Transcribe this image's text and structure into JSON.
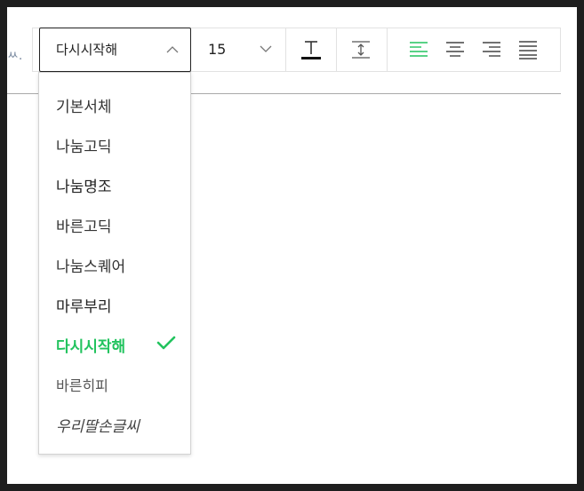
{
  "editor": {
    "left_fragment": "ㅆ."
  },
  "toolbar": {
    "font": {
      "selected": "다시시작해",
      "chevron_icon": "chevron-up-icon",
      "options": [
        {
          "label": "기본서체",
          "selected": false
        },
        {
          "label": "나눔고딕",
          "selected": false
        },
        {
          "label": "나눔명조",
          "selected": false
        },
        {
          "label": "바른고딕",
          "selected": false
        },
        {
          "label": "나눔스퀘어",
          "selected": false
        },
        {
          "label": "마루부리",
          "selected": false
        },
        {
          "label": "다시시작해",
          "selected": true
        },
        {
          "label": "바른히피",
          "selected": false
        },
        {
          "label": "우리딸손글씨",
          "selected": false
        }
      ]
    },
    "size": {
      "value": "15",
      "chevron_icon": "chevron-down-icon"
    },
    "buttons": [
      {
        "name": "text-color-button",
        "icon": "text-color-icon"
      },
      {
        "name": "line-height-button",
        "icon": "line-height-icon"
      },
      {
        "name": "align-left-button",
        "icon": "align-left-icon",
        "active": true
      },
      {
        "name": "align-center-button",
        "icon": "align-center-icon"
      },
      {
        "name": "align-right-button",
        "icon": "align-right-icon"
      },
      {
        "name": "align-justify-button",
        "icon": "align-justify-icon"
      }
    ]
  },
  "colors": {
    "accent": "#22c35e",
    "text": "#333333",
    "border": "#222222"
  }
}
